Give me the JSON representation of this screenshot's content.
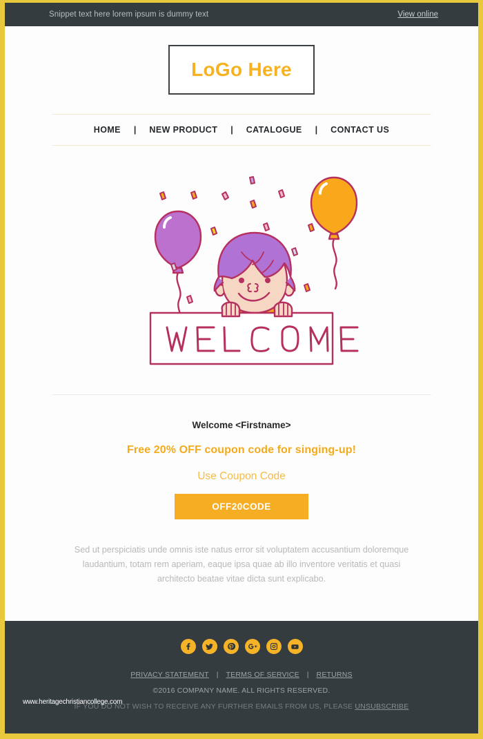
{
  "preheader": {
    "snippet": "Snippet text here lorem ipsum is dummy text",
    "view_online": "View online"
  },
  "header": {
    "logo_text": "LoGo Here"
  },
  "nav": {
    "separator": "|",
    "items": [
      {
        "label": "HOME"
      },
      {
        "label": "NEW PRODUCT"
      },
      {
        "label": "CATALOGUE"
      },
      {
        "label": "CONTACT US"
      }
    ]
  },
  "hero": {
    "sign_text": "WELCOME",
    "alt": "child with purple hair holding a welcome sign with balloons and confetti",
    "colors": {
      "outline": "#b5305f",
      "hair": "#b072d4",
      "skin": "#f6d7c4",
      "balloon_purple": "#bd71cf",
      "balloon_orange": "#f9a81c"
    }
  },
  "content": {
    "welcome": "Welcome <Firstname>",
    "offer": "Free 20% OFF coupon code for singing-up!",
    "coupon_label": "Use Coupon Code",
    "coupon_code": "OFF20CODE",
    "lorem": "Sed ut perspiciatis unde omnis iste natus error sit voluptatem accusantium doloremque laudantium, totam rem aperiam, eaque ipsa quae ab illo inventore veritatis et quasi architecto beatae vitae dicta sunt explicabo."
  },
  "footer": {
    "socials": [
      {
        "name": "facebook-icon",
        "label": "Facebook"
      },
      {
        "name": "twitter-icon",
        "label": "Twitter"
      },
      {
        "name": "pinterest-icon",
        "label": "Pinterest"
      },
      {
        "name": "google-plus-icon",
        "label": "Google Plus"
      },
      {
        "name": "instagram-icon",
        "label": "Instagram"
      },
      {
        "name": "youtube-icon",
        "label": "YouTube"
      }
    ],
    "links": [
      {
        "label": "PRIVACY STATEMENT"
      },
      {
        "label": "TERMS OF SERVICE"
      },
      {
        "label": "RETURNS"
      }
    ],
    "link_separator": "|",
    "copyright": "©2016 COMPANY NAME. ALL RIGHTS RESERVED.",
    "unsubscribe_prefix": "IF YOU DO NOT WISH TO RECEIVE ANY FURTHER EMAILS FROM US, PLEASE ",
    "unsubscribe_link": "UNSUBSCRIBE"
  },
  "watermark": {
    "text": "www.heritagechristiancollege.com"
  },
  "theme": {
    "border": "#e8c93e",
    "dark": "#353c3f",
    "accent": "#f5ad23",
    "accent_light": "#f7bb47"
  }
}
